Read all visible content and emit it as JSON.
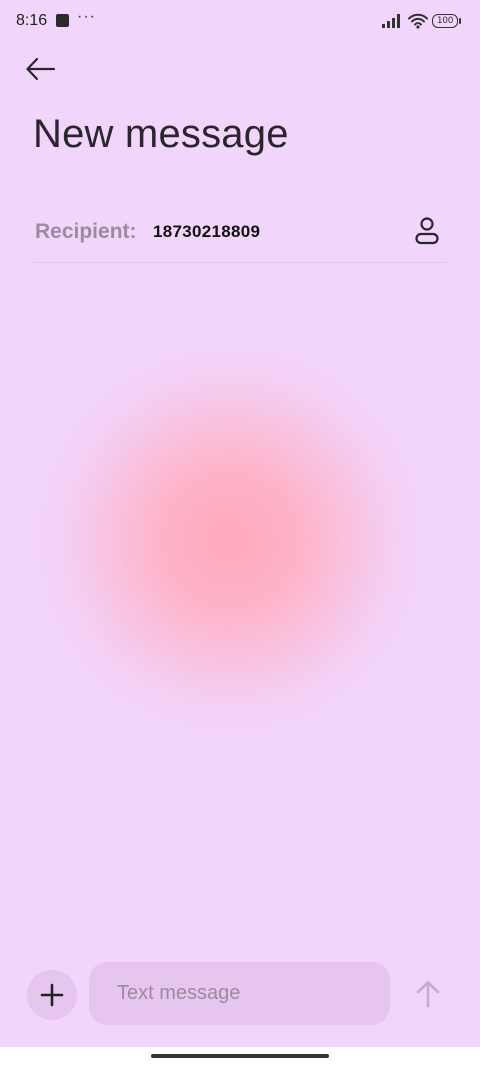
{
  "status_bar": {
    "time": "8:16",
    "more": "···",
    "battery": "100"
  },
  "header": {
    "title": "New message"
  },
  "recipient": {
    "label": "Recipient:",
    "value": "18730218809"
  },
  "composer": {
    "placeholder": "Text message"
  },
  "colors": {
    "background": "#f2d5fb",
    "input_background": "#e6c6ef",
    "label": "#9b8aa1",
    "blob": "#ffaabc"
  },
  "icons": {
    "back": "arrow-left-icon",
    "contact": "person-icon",
    "add": "plus-icon",
    "send": "arrow-up-icon"
  }
}
